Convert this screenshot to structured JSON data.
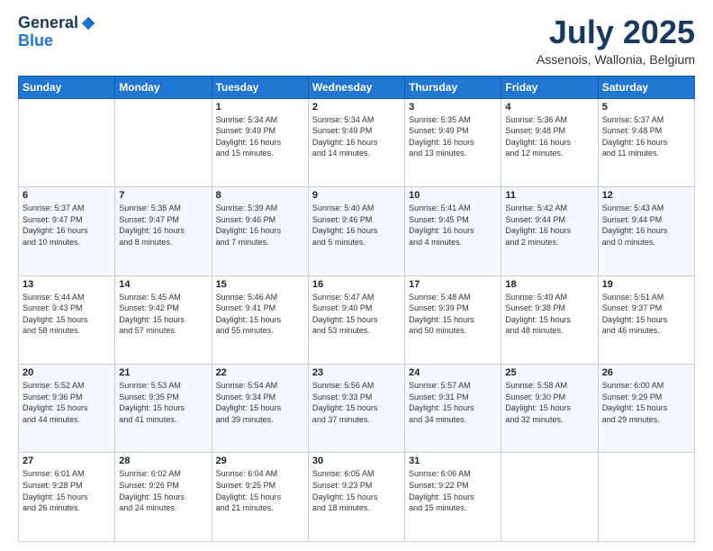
{
  "header": {
    "logo_line1": "General",
    "logo_line2": "Blue",
    "month": "July 2025",
    "location": "Assenois, Wallonia, Belgium"
  },
  "days_of_week": [
    "Sunday",
    "Monday",
    "Tuesday",
    "Wednesday",
    "Thursday",
    "Friday",
    "Saturday"
  ],
  "weeks": [
    [
      {
        "num": "",
        "info": ""
      },
      {
        "num": "",
        "info": ""
      },
      {
        "num": "1",
        "info": "Sunrise: 5:34 AM\nSunset: 9:49 PM\nDaylight: 16 hours\nand 15 minutes."
      },
      {
        "num": "2",
        "info": "Sunrise: 5:34 AM\nSunset: 9:49 PM\nDaylight: 16 hours\nand 14 minutes."
      },
      {
        "num": "3",
        "info": "Sunrise: 5:35 AM\nSunset: 9:49 PM\nDaylight: 16 hours\nand 13 minutes."
      },
      {
        "num": "4",
        "info": "Sunrise: 5:36 AM\nSunset: 9:48 PM\nDaylight: 16 hours\nand 12 minutes."
      },
      {
        "num": "5",
        "info": "Sunrise: 5:37 AM\nSunset: 9:48 PM\nDaylight: 16 hours\nand 11 minutes."
      }
    ],
    [
      {
        "num": "6",
        "info": "Sunrise: 5:37 AM\nSunset: 9:47 PM\nDaylight: 16 hours\nand 10 minutes."
      },
      {
        "num": "7",
        "info": "Sunrise: 5:38 AM\nSunset: 9:47 PM\nDaylight: 16 hours\nand 8 minutes."
      },
      {
        "num": "8",
        "info": "Sunrise: 5:39 AM\nSunset: 9:46 PM\nDaylight: 16 hours\nand 7 minutes."
      },
      {
        "num": "9",
        "info": "Sunrise: 5:40 AM\nSunset: 9:46 PM\nDaylight: 16 hours\nand 5 minutes."
      },
      {
        "num": "10",
        "info": "Sunrise: 5:41 AM\nSunset: 9:45 PM\nDaylight: 16 hours\nand 4 minutes."
      },
      {
        "num": "11",
        "info": "Sunrise: 5:42 AM\nSunset: 9:44 PM\nDaylight: 16 hours\nand 2 minutes."
      },
      {
        "num": "12",
        "info": "Sunrise: 5:43 AM\nSunset: 9:44 PM\nDaylight: 16 hours\nand 0 minutes."
      }
    ],
    [
      {
        "num": "13",
        "info": "Sunrise: 5:44 AM\nSunset: 9:43 PM\nDaylight: 15 hours\nand 58 minutes."
      },
      {
        "num": "14",
        "info": "Sunrise: 5:45 AM\nSunset: 9:42 PM\nDaylight: 15 hours\nand 57 minutes."
      },
      {
        "num": "15",
        "info": "Sunrise: 5:46 AM\nSunset: 9:41 PM\nDaylight: 15 hours\nand 55 minutes."
      },
      {
        "num": "16",
        "info": "Sunrise: 5:47 AM\nSunset: 9:40 PM\nDaylight: 15 hours\nand 53 minutes."
      },
      {
        "num": "17",
        "info": "Sunrise: 5:48 AM\nSunset: 9:39 PM\nDaylight: 15 hours\nand 50 minutes."
      },
      {
        "num": "18",
        "info": "Sunrise: 5:49 AM\nSunset: 9:38 PM\nDaylight: 15 hours\nand 48 minutes."
      },
      {
        "num": "19",
        "info": "Sunrise: 5:51 AM\nSunset: 9:37 PM\nDaylight: 15 hours\nand 46 minutes."
      }
    ],
    [
      {
        "num": "20",
        "info": "Sunrise: 5:52 AM\nSunset: 9:36 PM\nDaylight: 15 hours\nand 44 minutes."
      },
      {
        "num": "21",
        "info": "Sunrise: 5:53 AM\nSunset: 9:35 PM\nDaylight: 15 hours\nand 41 minutes."
      },
      {
        "num": "22",
        "info": "Sunrise: 5:54 AM\nSunset: 9:34 PM\nDaylight: 15 hours\nand 39 minutes."
      },
      {
        "num": "23",
        "info": "Sunrise: 5:56 AM\nSunset: 9:33 PM\nDaylight: 15 hours\nand 37 minutes."
      },
      {
        "num": "24",
        "info": "Sunrise: 5:57 AM\nSunset: 9:31 PM\nDaylight: 15 hours\nand 34 minutes."
      },
      {
        "num": "25",
        "info": "Sunrise: 5:58 AM\nSunset: 9:30 PM\nDaylight: 15 hours\nand 32 minutes."
      },
      {
        "num": "26",
        "info": "Sunrise: 6:00 AM\nSunset: 9:29 PM\nDaylight: 15 hours\nand 29 minutes."
      }
    ],
    [
      {
        "num": "27",
        "info": "Sunrise: 6:01 AM\nSunset: 9:28 PM\nDaylight: 15 hours\nand 26 minutes."
      },
      {
        "num": "28",
        "info": "Sunrise: 6:02 AM\nSunset: 9:26 PM\nDaylight: 15 hours\nand 24 minutes."
      },
      {
        "num": "29",
        "info": "Sunrise: 6:04 AM\nSunset: 9:25 PM\nDaylight: 15 hours\nand 21 minutes."
      },
      {
        "num": "30",
        "info": "Sunrise: 6:05 AM\nSunset: 9:23 PM\nDaylight: 15 hours\nand 18 minutes."
      },
      {
        "num": "31",
        "info": "Sunrise: 6:06 AM\nSunset: 9:22 PM\nDaylight: 15 hours\nand 15 minutes."
      },
      {
        "num": "",
        "info": ""
      },
      {
        "num": "",
        "info": ""
      }
    ]
  ]
}
